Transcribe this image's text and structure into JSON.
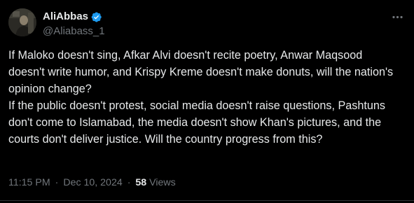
{
  "author": {
    "display_name": "AliAbbas",
    "handle": "@Aliabass_1",
    "verified_color": "#1d9bf0"
  },
  "tweet": {
    "paragraphs": [
      "If Maloko doesn't sing, Afkar Alvi doesn't recite poetry, Anwar Maqsood doesn't write humor, and Krispy Kreme doesn't make donuts, will the nation's opinion change?",
      "If the public doesn't protest, social media doesn't raise questions, Pashtuns don't come to Islamabad, the media doesn't show Khan's pictures, and the courts don't deliver justice. Will the country progress from this?"
    ],
    "time": "11:15 PM",
    "separator": "·",
    "date": "Dec 10, 2024",
    "views_count": "58",
    "views_label": "Views"
  },
  "icons": {
    "avatar": "profile-photo",
    "verified": "verified-badge-icon",
    "more": "more-options-icon"
  },
  "colors": {
    "background": "#000000",
    "text": "#e7e9ea",
    "secondary_text": "#71767b",
    "accent": "#1d9bf0"
  }
}
